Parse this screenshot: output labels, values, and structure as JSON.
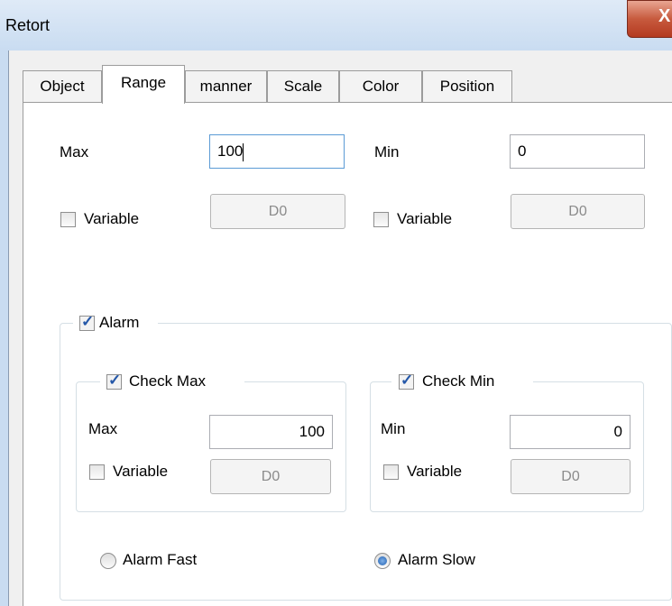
{
  "window": {
    "title": "Retort",
    "close_label": "X"
  },
  "tabs": [
    {
      "label": "Object",
      "active": false
    },
    {
      "label": "Range",
      "active": true
    },
    {
      "label": "manner",
      "active": false
    },
    {
      "label": "Scale",
      "active": false
    },
    {
      "label": "Color",
      "active": false
    },
    {
      "label": "Position",
      "active": false
    }
  ],
  "range": {
    "max_label": "Max",
    "max_value": "100",
    "min_label": "Min",
    "min_value": "0",
    "max_variable_label": "Variable",
    "max_variable_checked": false,
    "max_variable_button": "D0",
    "min_variable_label": "Variable",
    "min_variable_checked": false,
    "min_variable_button": "D0"
  },
  "alarm": {
    "label": "Alarm",
    "checked": true,
    "check_max": {
      "label": "Check Max",
      "checked": true,
      "field_label": "Max",
      "value": "100",
      "variable_label": "Variable",
      "variable_checked": false,
      "variable_button": "D0"
    },
    "check_min": {
      "label": "Check Min",
      "checked": true,
      "field_label": "Min",
      "value": "0",
      "variable_label": "Variable",
      "variable_checked": false,
      "variable_button": "D0"
    },
    "fast_label": "Alarm Fast",
    "fast_selected": false,
    "slow_label": "Alarm Slow",
    "slow_selected": true
  }
}
